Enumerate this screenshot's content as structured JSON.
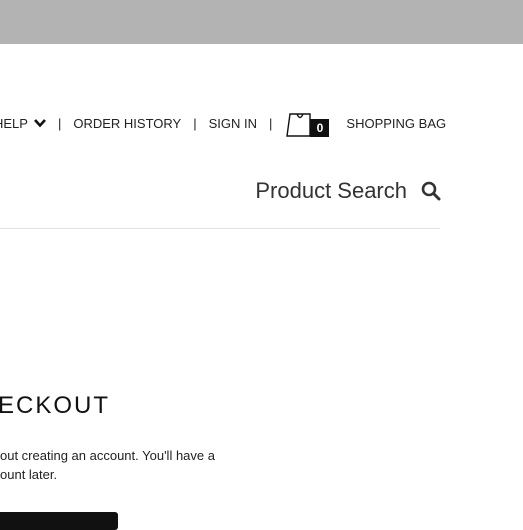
{
  "header": {
    "help_label": "HELP",
    "order_history_label": "ORDER HISTORY",
    "sign_in_label": "SIGN IN",
    "separator": "|",
    "bag_count": "0",
    "shopping_bag_label": "SHOPPING BAG"
  },
  "search": {
    "label": "Product Search"
  },
  "checkout": {
    "title": "ECKOUT",
    "desc_line1": "out creating an account. You'll have a",
    "desc_line2": "ount later."
  },
  "icons": {
    "help_chevron": "chevron-down-icon",
    "bag": "shopping-bag-icon",
    "search": "search-icon"
  }
}
